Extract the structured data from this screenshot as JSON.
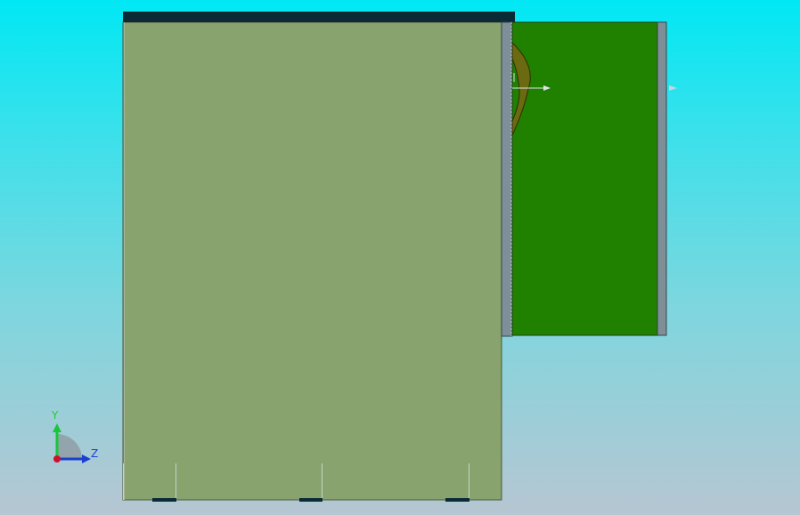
{
  "triad": {
    "y_label": "Y",
    "z_label": "Z",
    "y_color": "#19c63a",
    "z_color": "#1a3fd0",
    "origin_color": "#d0102a"
  },
  "colors": {
    "background_top": "#00e8f4",
    "background_bottom": "#b6c6d2",
    "main_plate": "#88a36d",
    "top_cap": "#0a2a36",
    "side_block": "#208000",
    "flange": "#7f8f98",
    "arc": "#6b6a10"
  }
}
